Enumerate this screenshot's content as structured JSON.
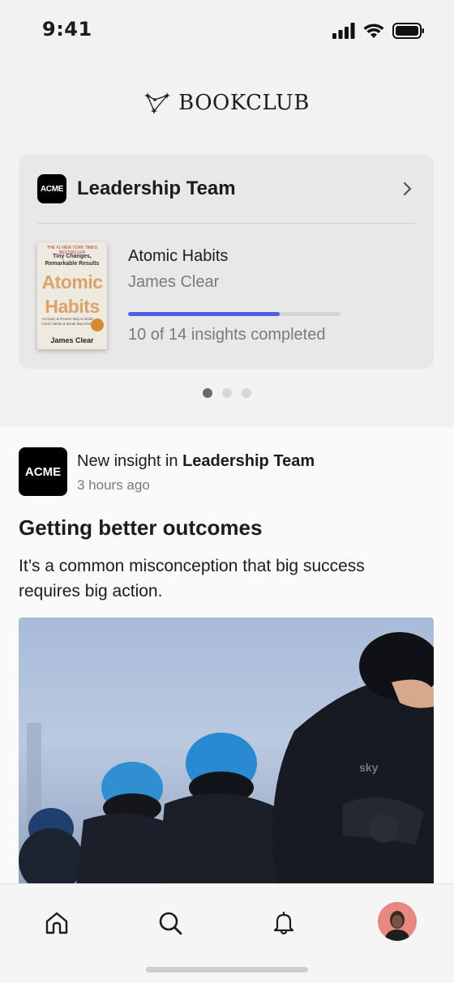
{
  "status_bar": {
    "time": "9:41"
  },
  "header": {
    "logo_text": "BOOKCLUB",
    "logo_icon": "constellation-icon"
  },
  "club_card": {
    "club_logo_text": "ACME",
    "club_name": "Leadership Team",
    "book": {
      "cover": {
        "top_banner": "THE #1 NEW YORK TIMES BESTSELLER",
        "subtitle": "Tiny Changes, Remarkable Results",
        "title": "Atomic Habits",
        "tagline": "An Easy & Proven Way to Build Good Habits & Break Bad Ones",
        "author": "James Clear"
      },
      "title": "Atomic Habits",
      "author": "James Clear",
      "progress_fraction": 0.714,
      "progress_text": "10 of 14 insights completed"
    }
  },
  "carousel": {
    "pages": 3,
    "active_index": 0
  },
  "feed": {
    "post": {
      "club_logo_text": "ACME",
      "meta_prefix": "New insight in",
      "meta_club": "Leadership Team",
      "time_ago": "3 hours ago",
      "title": "Getting better outcomes",
      "body": "It’s a common misconception that big success requires big action."
    }
  },
  "tab_bar": {
    "items": [
      {
        "name": "home-icon"
      },
      {
        "name": "search-icon"
      },
      {
        "name": "bell-icon"
      },
      {
        "name": "profile-avatar"
      }
    ]
  },
  "colors": {
    "accent": "#4e5ee4",
    "card_bg": "#e8e8e8",
    "avatar_bg": "#e98782"
  }
}
